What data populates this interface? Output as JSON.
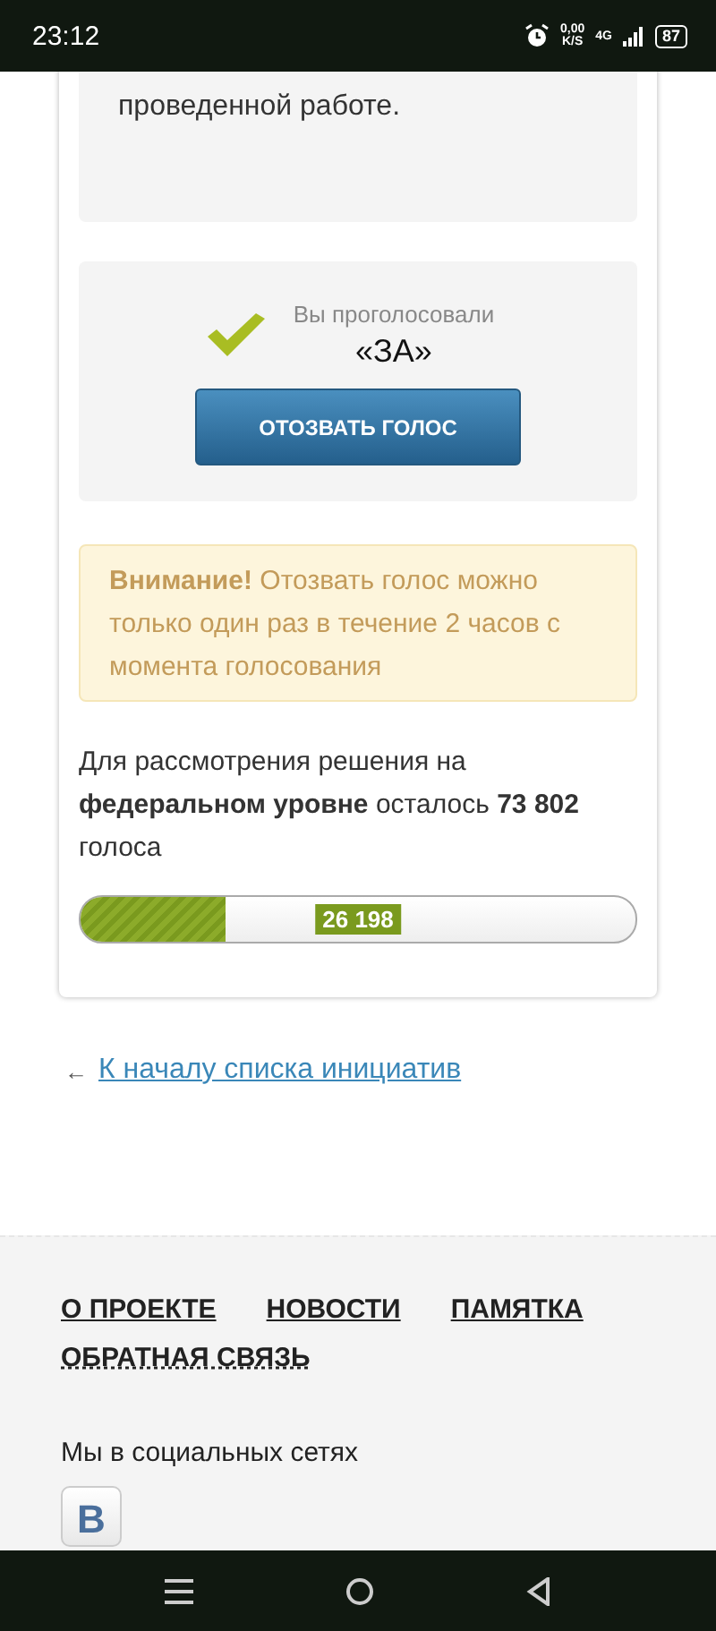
{
  "status_bar": {
    "time": "23:12",
    "speed_value": "0,00",
    "speed_unit": "K/S",
    "network": "4G",
    "battery": "87"
  },
  "description": {
    "lines": [
      "проведенной работе."
    ]
  },
  "vote": {
    "caption": "Вы проголосовали",
    "choice": "«ЗА»",
    "button": "ОТОЗВАТЬ ГОЛОС"
  },
  "warning": "**Внимание!** Отозвать голос можно только один раз в течение 2 часов с момента голосования",
  "remaining": "Для рассмотрения решения на **федеральном уровне** осталось **73 802** голоса",
  "progress": {
    "level": 0.262,
    "label": "26 198"
  },
  "back_link": {
    "arrow": "←",
    "label": "К началу списка инициатив"
  },
  "footer": {
    "links": [
      {
        "label": "О ПРОЕКТЕ",
        "kind": "solid"
      },
      {
        "label": "НОВОСТИ",
        "kind": "solid"
      },
      {
        "label": "ПАМЯТКА",
        "kind": "solid"
      },
      {
        "label": "ОБРАТНАЯ СВЯЗЬ",
        "kind": "dotted"
      }
    ],
    "social_title": "Мы в социальных сетях",
    "social_button": "В"
  }
}
